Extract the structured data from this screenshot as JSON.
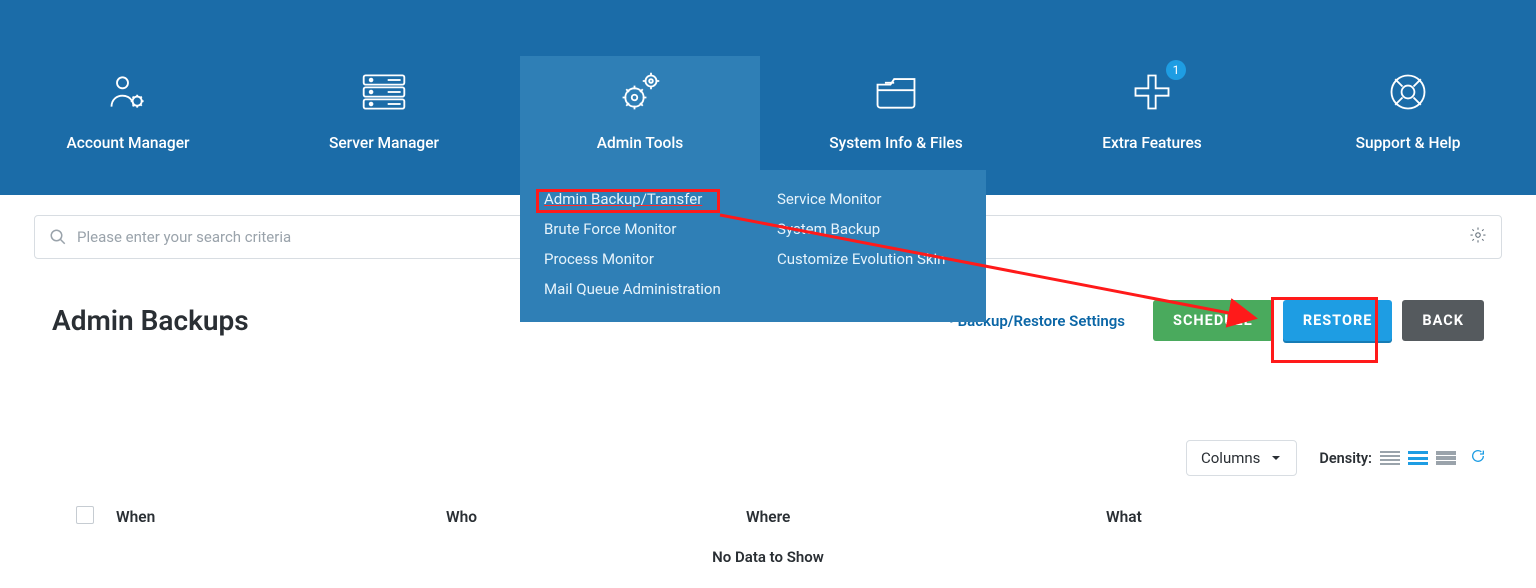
{
  "nav": {
    "items": [
      {
        "label": "Account Manager"
      },
      {
        "label": "Server Manager"
      },
      {
        "label": "Admin Tools"
      },
      {
        "label": "System Info & Files"
      },
      {
        "label": "Extra Features",
        "badge": "1"
      },
      {
        "label": "Support & Help"
      }
    ]
  },
  "dropdown": {
    "col1": [
      "Admin Backup/Transfer",
      "Brute Force Monitor",
      "Process Monitor",
      "Mail Queue Administration"
    ],
    "col2": [
      "Service Monitor",
      "System Backup",
      "Customize Evolution Skin"
    ]
  },
  "search": {
    "placeholder": "Please enter your search criteria"
  },
  "page": {
    "title": "Admin Backups",
    "settings_link": "Backup/Restore Settings",
    "buttons": {
      "schedule": "SCHEDULE",
      "restore": "RESTORE",
      "back": "BACK"
    }
  },
  "toolbar": {
    "columns_label": "Columns",
    "density_label": "Density:"
  },
  "table": {
    "headers": {
      "when": "When",
      "who": "Who",
      "where": "Where",
      "what": "What"
    },
    "empty": "No Data to Show"
  },
  "annotations": {
    "highlighted_menu_item": "Admin Backup/Transfer",
    "highlighted_button": "RESTORE",
    "arrow_from": "Admin Backup/Transfer menu item",
    "arrow_to": "RESTORE button"
  }
}
